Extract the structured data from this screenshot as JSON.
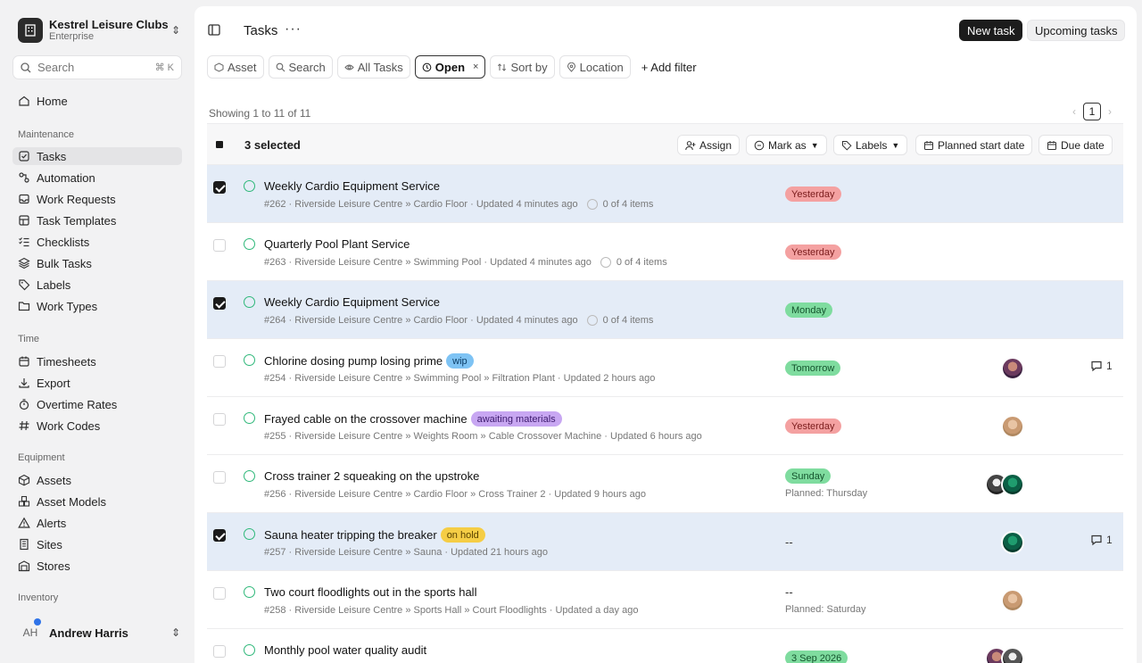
{
  "org": {
    "name": "Kestrel Leisure Clubs",
    "plan": "Enterprise"
  },
  "search": {
    "placeholder": "Search",
    "shortcut": "⌘ K"
  },
  "nav": {
    "home": "Home",
    "maintenance_label": "Maintenance",
    "maintenance": [
      "Tasks",
      "Automation",
      "Work Requests",
      "Task Templates",
      "Checklists",
      "Bulk Tasks",
      "Labels",
      "Work Types"
    ],
    "time_label": "Time",
    "time": [
      "Timesheets",
      "Export",
      "Overtime Rates",
      "Work Codes"
    ],
    "equipment_label": "Equipment",
    "equipment": [
      "Assets",
      "Asset Models",
      "Alerts",
      "Sites",
      "Stores"
    ],
    "inventory_label": "Inventory"
  },
  "user": {
    "initials": "AH",
    "name": "Andrew Harris"
  },
  "header": {
    "title": "Tasks",
    "more": "···",
    "new_task": "New task",
    "upcoming": "Upcoming tasks"
  },
  "filters": {
    "asset": "Asset",
    "search": "Search",
    "all_tasks": "All Tasks",
    "open": "Open",
    "open_close": "×",
    "sort_by": "Sort by",
    "location": "Location",
    "add_filter": "+ Add filter"
  },
  "listing": {
    "showing": "Showing 1 to 11 of 11",
    "page": "1",
    "prev": "‹",
    "next": "›"
  },
  "bulk": {
    "selected": "3 selected",
    "assign": "Assign",
    "mark_as": "Mark as",
    "labels": "Labels",
    "planned_start": "Planned start date",
    "due_date": "Due date"
  },
  "colors": {
    "accent_selected_row": "#e4ecf7",
    "status_green": "#2fb87a",
    "badge_red": "#f4a1a1",
    "badge_green": "#7fdc9f"
  },
  "tasks": [
    {
      "selected": true,
      "title": "Weekly Cardio Equipment Service",
      "meta": "#262 · Riverside Leisure Centre » Cardio Floor · Updated 4 minutes ago",
      "items": "0 of 4 items",
      "due": "Yesterday",
      "due_color": "red"
    },
    {
      "selected": false,
      "title": "Quarterly Pool Plant Service",
      "meta": "#263 · Riverside Leisure Centre » Swimming Pool · Updated 4 minutes ago",
      "items": "0 of 4 items",
      "due": "Yesterday",
      "due_color": "red"
    },
    {
      "selected": true,
      "title": "Weekly Cardio Equipment Service",
      "meta": "#264 · Riverside Leisure Centre » Cardio Floor · Updated 4 minutes ago",
      "items": "0 of 4 items",
      "due": "Monday",
      "due_color": "green"
    },
    {
      "selected": false,
      "title": "Chlorine dosing pump losing prime",
      "tag": "wip",
      "meta": "#254 · Riverside Leisure Centre » Swimming Pool » Filtration Plant · Updated 2 hours ago",
      "due": "Tomorrow",
      "due_color": "green",
      "comments": "1"
    },
    {
      "selected": false,
      "title": "Frayed cable on the crossover machine",
      "tag": "awaiting materials",
      "meta": "#255 · Riverside Leisure Centre » Weights Room » Cable Crossover Machine · Updated 6 hours ago",
      "due": "Yesterday",
      "due_color": "red"
    },
    {
      "selected": false,
      "title": "Cross trainer 2 squeaking on the upstroke",
      "meta": "#256 · Riverside Leisure Centre » Cardio Floor » Cross Trainer 2 · Updated 9 hours ago",
      "due": "Sunday",
      "due_color": "green",
      "planned": "Planned: Thursday"
    },
    {
      "selected": true,
      "title": "Sauna heater tripping the breaker",
      "tag": "on hold",
      "meta": "#257 · Riverside Leisure Centre » Sauna · Updated 21 hours ago",
      "due": "--",
      "comments": "1"
    },
    {
      "selected": false,
      "title": "Two court floodlights out in the sports hall",
      "meta": "#258 · Riverside Leisure Centre » Sports Hall » Court Floodlights · Updated a day ago",
      "due": "--",
      "planned": "Planned: Saturday"
    },
    {
      "selected": false,
      "title": "Monthly pool water quality audit",
      "due": "3 Sep 2026",
      "due_color": "green"
    }
  ]
}
